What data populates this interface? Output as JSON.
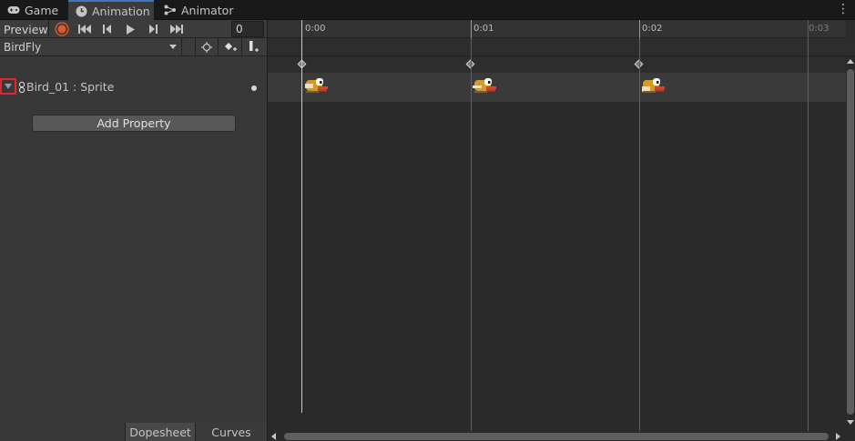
{
  "tabs": [
    {
      "label": "Game",
      "icon": "gamepad-icon",
      "active": false
    },
    {
      "label": "Animation",
      "icon": "clock-icon",
      "active": true
    },
    {
      "label": "Animator",
      "icon": "animator-icon",
      "active": false
    }
  ],
  "toolbar": {
    "preview_label": "Preview",
    "frame_value": "0",
    "clip_name": "BirdFly"
  },
  "property": {
    "label": "Bird_01 : Sprite"
  },
  "add_property_label": "Add Property",
  "bottom_tabs": {
    "dopesheet": "Dopesheet",
    "curves": "Curves"
  },
  "timeline": {
    "ruler_labels": [
      "0:00",
      "0:01",
      "0:02",
      "0:03"
    ],
    "keyframe_count": 3
  },
  "colors": {
    "record_button": "#e05a2b",
    "active_tab_accent": "#3a79bb",
    "foldout_highlight": "#e0252f"
  }
}
